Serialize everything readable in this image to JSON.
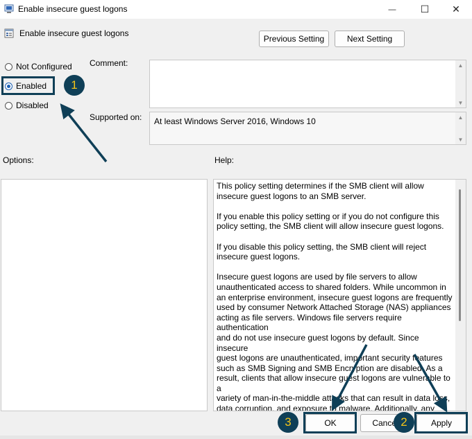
{
  "window": {
    "title": "Enable insecure guest logons",
    "minimize_glyph": "—",
    "maximize_glyph": "☐",
    "close_glyph": "✕"
  },
  "header": {
    "title": "Enable insecure guest logons",
    "previous_label": "Previous Setting",
    "next_label": "Next Setting"
  },
  "state": {
    "options": [
      {
        "label": "Not Configured",
        "checked": false
      },
      {
        "label": "Enabled",
        "checked": true
      },
      {
        "label": "Disabled",
        "checked": false
      }
    ]
  },
  "comment": {
    "label": "Comment:",
    "value": ""
  },
  "supported": {
    "label": "Supported on:",
    "value": "At least Windows Server 2016, Windows 10"
  },
  "options_label": "Options:",
  "help": {
    "label": "Help:",
    "text": "This policy setting determines if the SMB client will allow\ninsecure guest logons to an SMB server.\n\nIf you enable this policy setting or if you do not configure this\npolicy setting, the SMB client will allow insecure guest logons.\n\nIf you disable this policy setting, the SMB client will reject\ninsecure guest logons.\n\nInsecure guest logons are used by file servers to allow\nunauthenticated access to shared folders. While uncommon in\nan enterprise environment, insecure guest logons are frequently\nused by consumer Network Attached Storage (NAS) appliances\nacting as file servers. Windows file servers require authentication\nand do not use insecure guest logons by default. Since insecure\nguest logons are unauthenticated, important security features\nsuch as SMB Signing and SMB Encryption are disabled. As a\nresult, clients that allow insecure guest logons are vulnerable to a\nvariety of man-in-the-middle attacks that can result in data loss,\ndata corruption, and exposure to malware. Additionally, any data\nwritten to a file server using an insecure guest logon is"
  },
  "footer": {
    "ok_label": "OK",
    "cancel_label": "Cancel",
    "apply_label": "Apply"
  },
  "annotations": {
    "badges": [
      "1",
      "2",
      "3"
    ],
    "color": "#0f3f57",
    "badge_text_color": "#f5c518"
  }
}
